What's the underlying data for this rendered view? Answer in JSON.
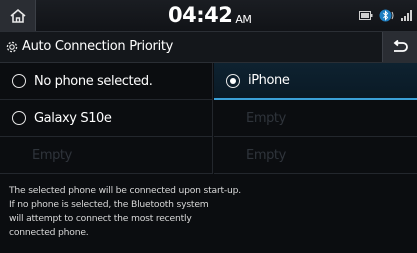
{
  "status_bar": {
    "time": "04:42",
    "ampm": "AM",
    "icons": [
      "home-icon",
      "battery-icon",
      "bluetooth-icon",
      "signal-icon"
    ]
  },
  "header": {
    "title": "Auto Connection Priority",
    "icons": [
      "gear-icon",
      "back-icon"
    ]
  },
  "options": {
    "left": [
      {
        "label": "No phone selected.",
        "selected": false
      },
      {
        "label": "Galaxy S10e",
        "selected": false
      },
      {
        "label": "Empty"
      }
    ],
    "right": [
      {
        "label": "iPhone",
        "selected": true
      },
      {
        "label": "Empty"
      },
      {
        "label": "Empty"
      }
    ]
  },
  "description": [
    "The selected phone will be connected upon start-up.",
    "If no phone is selected, the Bluetooth system",
    "will attempt to connect the most recently",
    "connected phone."
  ],
  "colors": {
    "accent": "#3ba1d8",
    "background": "#0b0d10",
    "empty_text": "#2f343b"
  }
}
